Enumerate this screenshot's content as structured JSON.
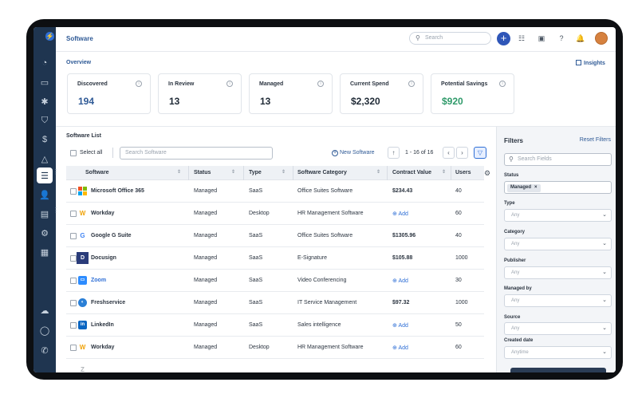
{
  "header": {
    "title": "Software",
    "search_placeholder": "Search"
  },
  "overview": {
    "title": "Overview",
    "insights_label": "Insights",
    "cards": [
      {
        "label": "Discovered",
        "value": "194",
        "color": "#2f5a96"
      },
      {
        "label": "In Review",
        "value": "13",
        "color": "#1f2a36"
      },
      {
        "label": "Managed",
        "value": "13",
        "color": "#1f2a36"
      },
      {
        "label": "Current Spend",
        "value": "$2,320",
        "color": "#1f2a36"
      },
      {
        "label": "Potential Savings",
        "value": "$920",
        "color": "#2f9a6a"
      }
    ]
  },
  "list": {
    "title": "Software List",
    "select_all": "Select all",
    "search_placeholder": "Search Software",
    "new_software": "New Software",
    "pager": "1 - 16 of 16",
    "columns": [
      "Software",
      "Status",
      "Type",
      "Software Category",
      "Contract Value",
      "Users"
    ],
    "rows": [
      {
        "name": "Microsoft Office 365",
        "icon": "microsoft-logo-icon",
        "status": "Managed",
        "type": "SaaS",
        "category": "Office Suites Software",
        "contract": "$234.43",
        "users": "40"
      },
      {
        "name": "Workday",
        "icon": "workday-logo-icon",
        "status": "Managed",
        "type": "Desktop",
        "category": "HR Management Software",
        "contract": "Add",
        "users": "60"
      },
      {
        "name": "Google G Suite",
        "icon": "google-logo-icon",
        "status": "Managed",
        "type": "SaaS",
        "category": "Office Suites Software",
        "contract": "$1305.96",
        "users": "40"
      },
      {
        "name": "Docusign",
        "icon": "docusign-logo-icon",
        "status": "Managed",
        "type": "SaaS",
        "category": "E-Signature",
        "contract": "$105.88",
        "users": "1000"
      },
      {
        "name": "Zoom",
        "icon": "zoom-logo-icon",
        "status": "Managed",
        "type": "SaaS",
        "category": "Video Conferencing",
        "contract": "Add",
        "users": "30"
      },
      {
        "name": "Freshservice",
        "icon": "freshservice-logo-icon",
        "status": "Managed",
        "type": "SaaS",
        "category": "IT Service Management",
        "contract": "$97.32",
        "users": "1000"
      },
      {
        "name": "LinkedIn",
        "icon": "linkedin-logo-icon",
        "status": "Managed",
        "type": "SaaS",
        "category": "Sales intelligence",
        "contract": "Add",
        "users": "50"
      },
      {
        "name": "Workday",
        "icon": "workday-logo-icon",
        "status": "Managed",
        "type": "Desktop",
        "category": "HR Management Software",
        "contract": "Add",
        "users": "60"
      }
    ]
  },
  "filters": {
    "title": "Filters",
    "reset": "Reset Filters",
    "search_placeholder": "Search Fields",
    "status_label": "Status",
    "status_chip": "Managed",
    "fields": [
      {
        "label": "Type",
        "value": "Any"
      },
      {
        "label": "Category",
        "value": "Any"
      },
      {
        "label": "Publisher",
        "value": "Any"
      },
      {
        "label": "Managed by",
        "value": "Any"
      },
      {
        "label": "Source",
        "value": "Any"
      },
      {
        "label": "Created date",
        "value": "Anytime"
      }
    ]
  }
}
